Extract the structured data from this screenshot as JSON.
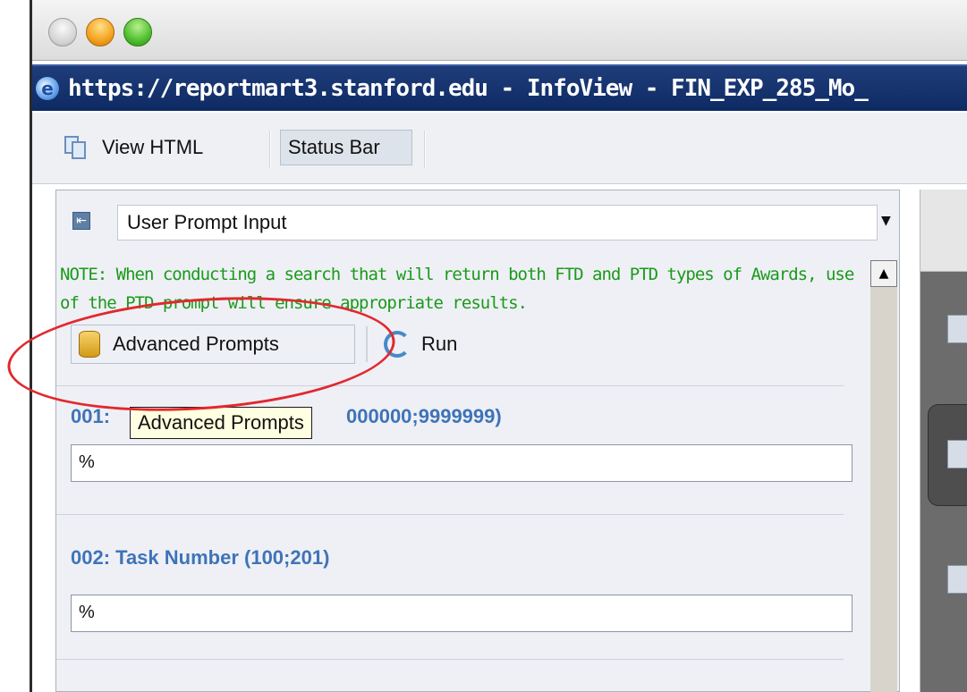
{
  "window": {
    "title": "https://reportmart3.stanford.edu - InfoView - FIN_EXP_285_Mo_",
    "ie_icon": "ie-icon"
  },
  "toolbar": {
    "view_html_label": "View HTML",
    "status_bar_label": "Status Bar"
  },
  "panel": {
    "select_value": "User Prompt Input",
    "note": "NOTE: When conducting a search that will return both FTD and PTD types of Awards, use of the PTD prompt will ensure appropriate results.",
    "advanced_prompts_label": "Advanced Prompts",
    "run_label": "Run",
    "tooltip": "Advanced Prompts",
    "prompts": [
      {
        "label_visible_prefix": "001:",
        "label_visible_suffix": "000000;9999999)",
        "value": "%"
      },
      {
        "label": "002: Task Number (100;201)",
        "value": "%"
      }
    ]
  },
  "annotation": {
    "color": "#e2282d"
  }
}
